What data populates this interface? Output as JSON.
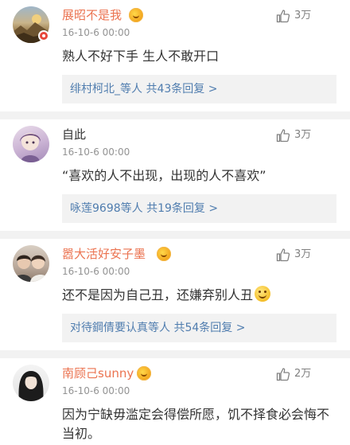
{
  "comments": [
    {
      "username": "展昭不是我",
      "timestamp": "16-10-6 00:00",
      "likes": "3万",
      "text": "熟人不好下手 生人不敢开口",
      "reply_prefix": "绯村柯北_等人 共",
      "reply_count": "43",
      "reply_suffix": "条回复 >"
    },
    {
      "username": "自此",
      "timestamp": "16-10-6 00:00",
      "likes": "3万",
      "text": "“喜欢的人不出现，出现的人不喜欢”",
      "reply_prefix": "咏莲9698等人 共",
      "reply_count": "19",
      "reply_suffix": "条回复 >"
    },
    {
      "username": "嚣大活好安子墨",
      "timestamp": "16-10-6 00:00",
      "likes": "3万",
      "text": "还不是因为自己丑，还嫌弃别人丑",
      "reply_prefix": "对待鋼倩要认真等人 共",
      "reply_count": "54",
      "reply_suffix": "条回复 >"
    },
    {
      "username": "南顾己sunny",
      "timestamp": "16-10-6 00:00",
      "likes": "2万",
      "text": "因为宁缺毋滥定会得偿所愿，饥不择食必会悔不当初。"
    }
  ],
  "icons": {
    "like": "thumbs-up-icon",
    "level": "level-badge-icon",
    "verified": "verified-badge-icon",
    "emoji": "smile-emoji-icon"
  },
  "colors": {
    "vip_name": "#eb7350",
    "link": "#507daf",
    "reply_bg": "#f2f2f2",
    "separator": "#f2f2f2",
    "text": "#333333",
    "meta": "#939393"
  }
}
